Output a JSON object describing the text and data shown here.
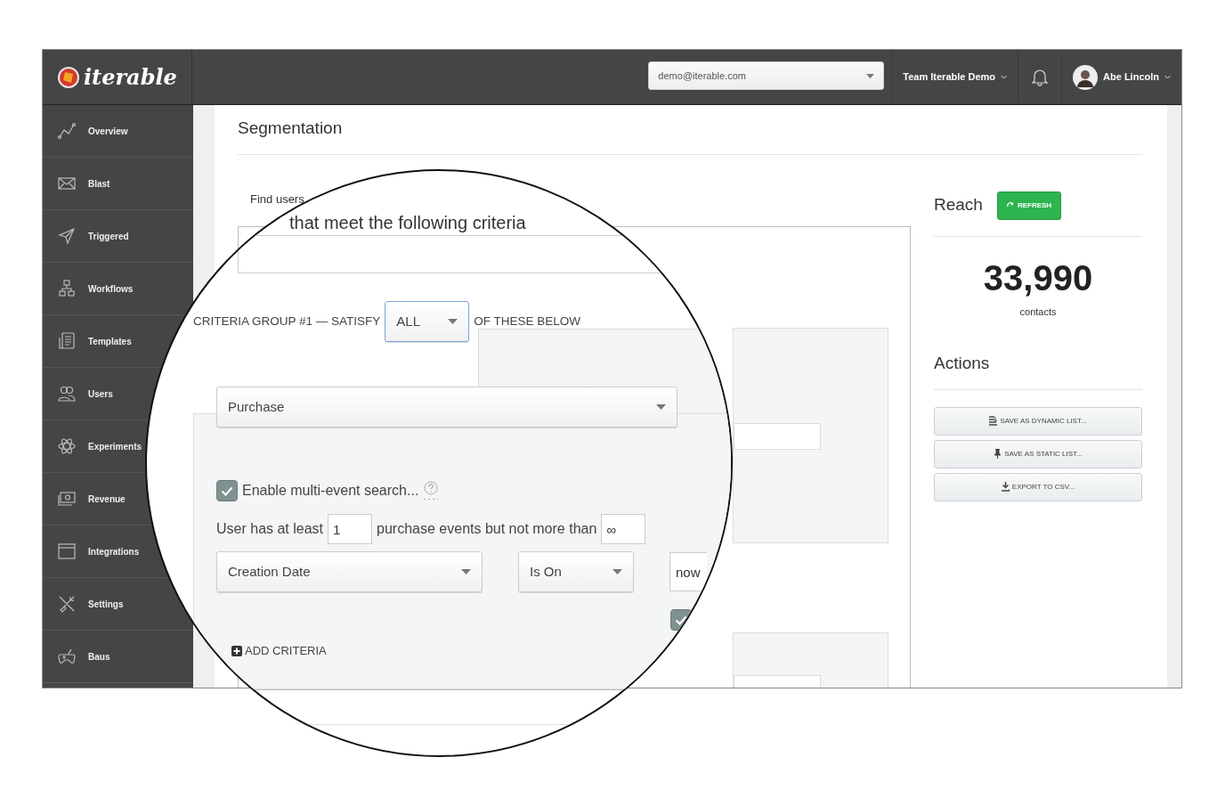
{
  "app": {
    "logo": "iterable"
  },
  "topbar": {
    "account_select": "demo@iterable.com",
    "team": "Team Iterable Demo",
    "user": "Abe Lincoln"
  },
  "sidebar": {
    "items": [
      {
        "label": "Overview"
      },
      {
        "label": "Blast"
      },
      {
        "label": "Triggered"
      },
      {
        "label": "Workflows"
      },
      {
        "label": "Templates"
      },
      {
        "label": "Users"
      },
      {
        "label": "Experiments"
      },
      {
        "label": "Revenue"
      },
      {
        "label": "Integrations"
      },
      {
        "label": "Settings"
      },
      {
        "label": "Baus"
      }
    ]
  },
  "page": {
    "title": "Segmentation",
    "find_label": "Find users"
  },
  "magnifier": {
    "heading": "that meet the following criteria",
    "group_label": "CRITERIA GROUP #1 — SATISFY",
    "group_mode": "ALL",
    "group_suffix": "OF THESE BELOW",
    "event_select": "Purchase",
    "multi_event": {
      "label": "Enable multi-event search...",
      "checked": true
    },
    "count_prefix": "User has at least",
    "min_count": "1",
    "count_middle": "purchase events but not more than",
    "max_count": "∞",
    "field_select": "Creation Date",
    "operator_select": "Is On",
    "date_value": "now",
    "second_checkbox": {
      "checked": true
    },
    "add_criteria": "ADD CRITERIA"
  },
  "reach": {
    "title": "Reach",
    "refresh": "REFRESH",
    "count": "33,990",
    "unit": "contacts"
  },
  "actions": {
    "title": "Actions",
    "buttons": [
      {
        "label": "SAVE AS DYNAMIC LIST..."
      },
      {
        "label": "SAVE AS STATIC LIST..."
      },
      {
        "label": "EXPORT TO CSV..."
      }
    ]
  }
}
